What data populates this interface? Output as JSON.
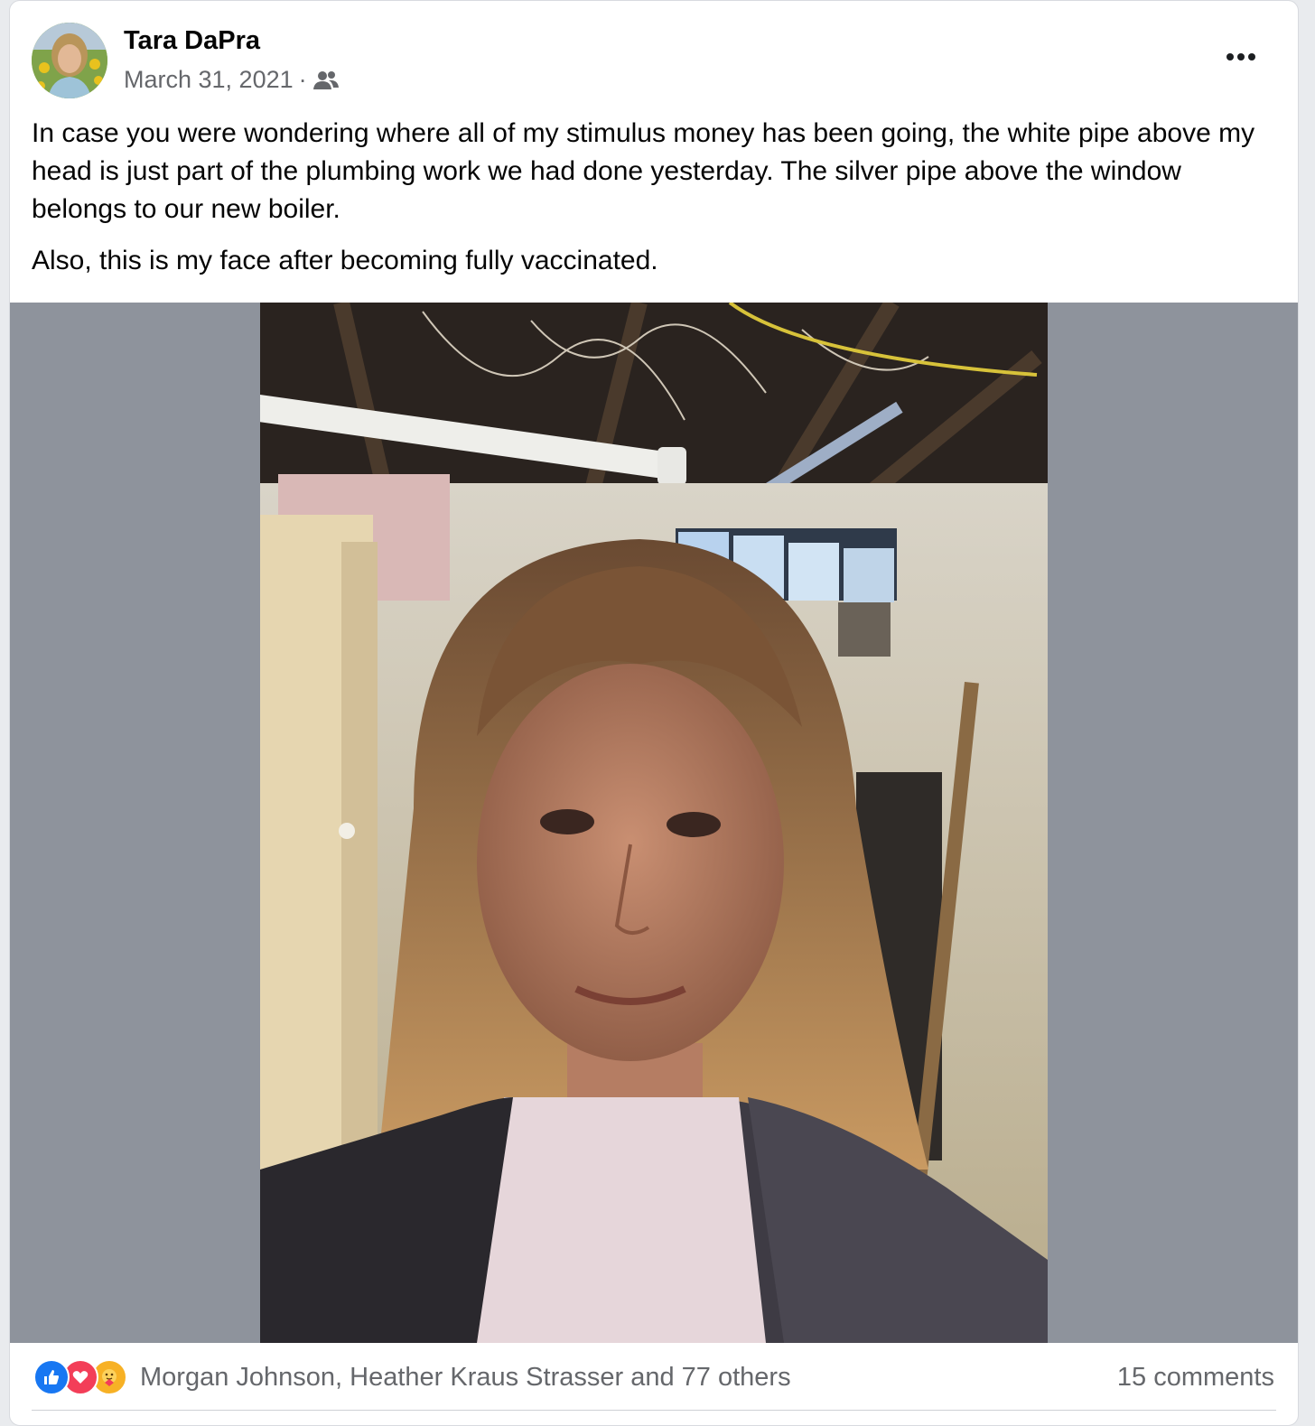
{
  "post": {
    "author": "Tara DaPra",
    "date": "March 31, 2021",
    "separator": "·",
    "audience_icon": "friends-icon",
    "more_icon": "more-options-icon",
    "paragraphs": [
      "In case you were wondering where all of my stimulus money has been going, the white pipe above my head is just part of the plumbing work we had done yesterday. The silver pipe above the window belongs to our new boiler.",
      "Also, this is my face after becoming fully vaccinated."
    ]
  },
  "reactions": {
    "icons": [
      "like-reaction-icon",
      "love-reaction-icon",
      "care-reaction-icon"
    ],
    "summary": "Morgan Johnson, Heather Kraus Strasser and 77 others",
    "comments": "15 comments"
  },
  "colors": {
    "photo_backdrop": "#8e939c",
    "like": "#1877f2",
    "love": "#f33e58",
    "care": "#f7b125",
    "secondary_text": "#65676b"
  }
}
